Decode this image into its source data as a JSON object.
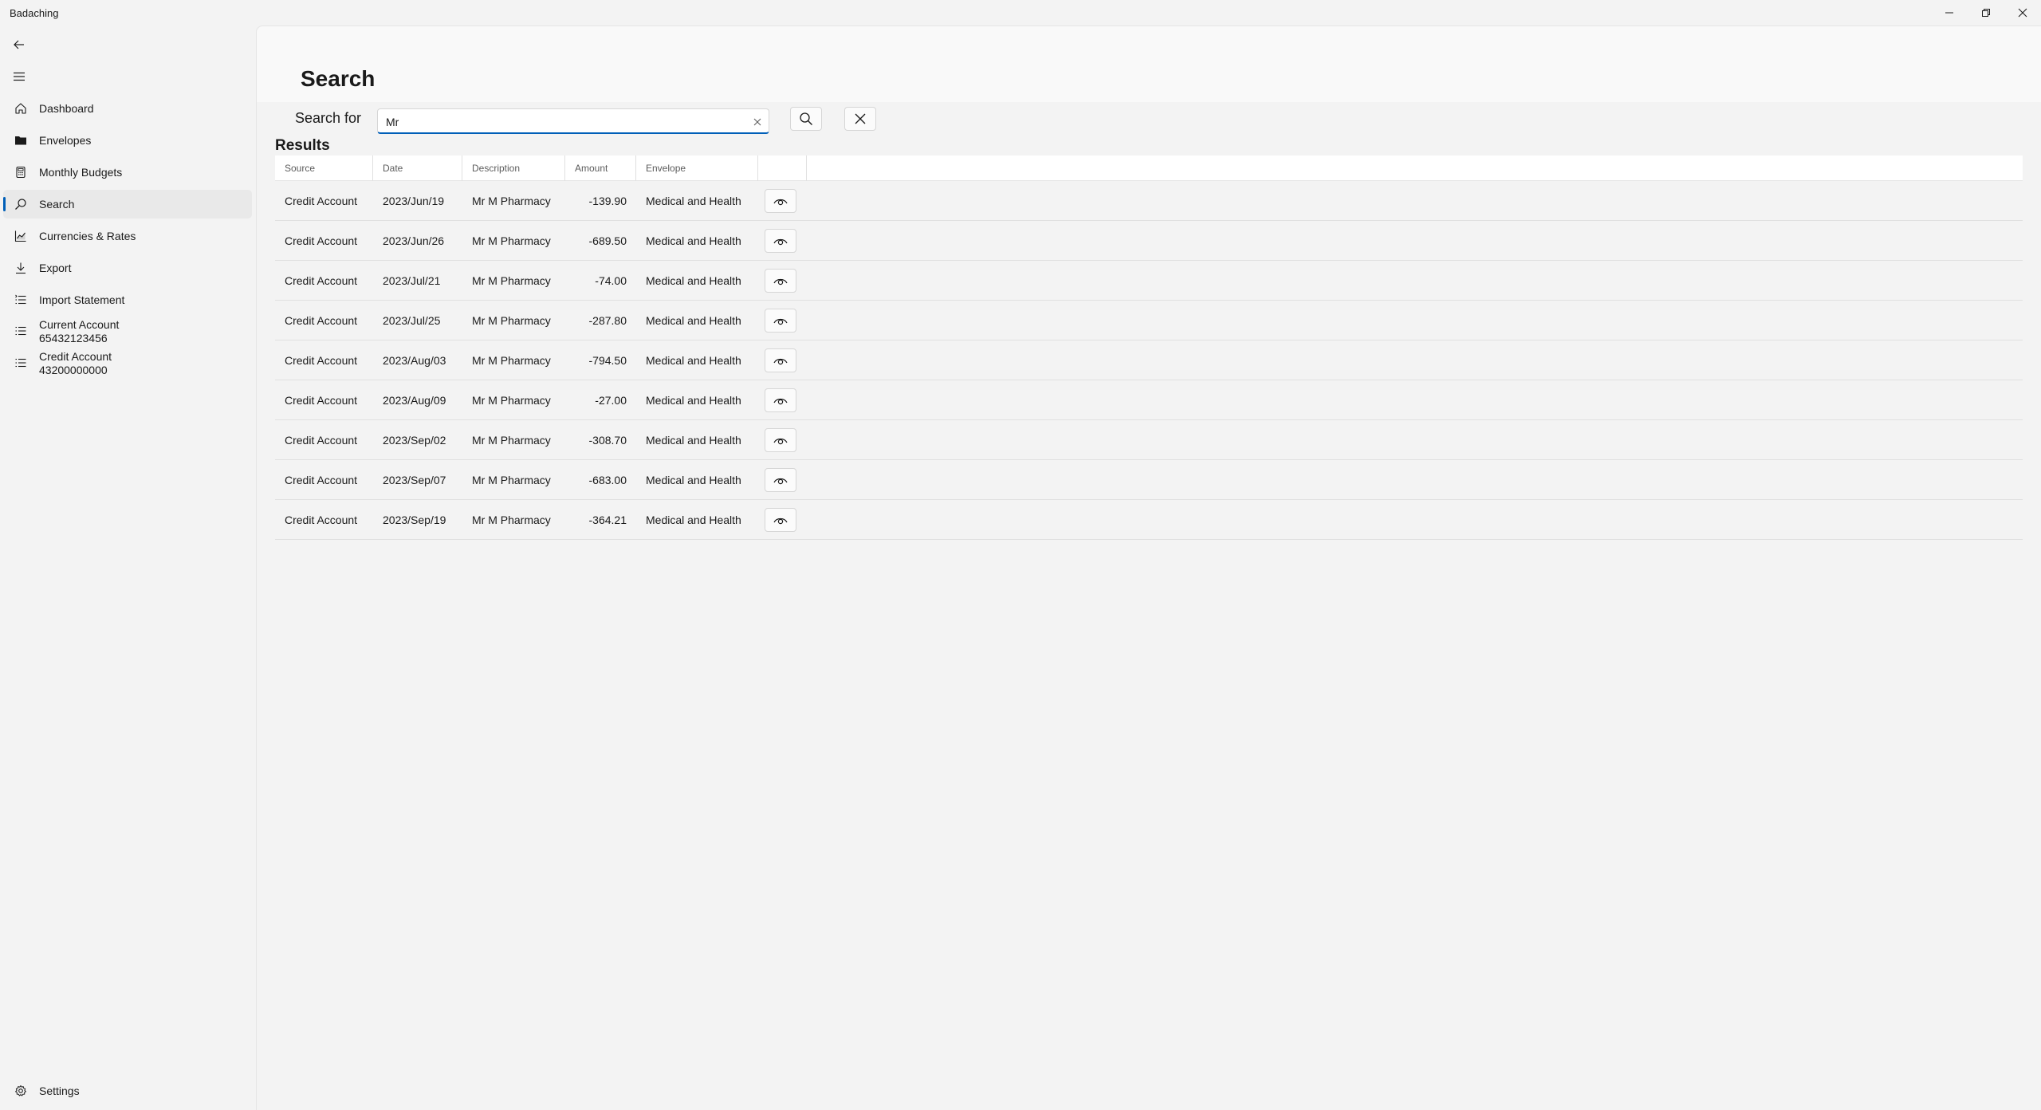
{
  "app": {
    "title": "Badaching"
  },
  "sidebar": {
    "items": [
      {
        "label": "Dashboard",
        "icon": "home-icon"
      },
      {
        "label": "Envelopes",
        "icon": "folder-icon"
      },
      {
        "label": "Monthly Budgets",
        "icon": "calculator-icon"
      },
      {
        "label": "Search",
        "icon": "search-icon",
        "selected": true
      },
      {
        "label": "Currencies & Rates",
        "icon": "chart-icon"
      },
      {
        "label": "Export",
        "icon": "download-icon"
      },
      {
        "label": "Import Statement",
        "icon": "list-import-icon"
      }
    ],
    "accounts": [
      {
        "name": "Current Account",
        "number": "65432123456"
      },
      {
        "name": "Credit Account",
        "number": "43200000000"
      }
    ],
    "settings_label": "Settings"
  },
  "main": {
    "title": "Search",
    "search_label": "Search for",
    "search_value": "Mr",
    "results_title": "Results"
  },
  "table": {
    "headers": [
      "Source",
      "Date",
      "Description",
      "Amount",
      "Envelope"
    ],
    "rows": [
      [
        "Credit Account",
        "2023/Jun/19",
        "Mr M Pharmacy",
        "-139.90",
        "Medical and Health"
      ],
      [
        "Credit Account",
        "2023/Jun/26",
        "Mr M Pharmacy",
        "-689.50",
        "Medical and Health"
      ],
      [
        "Credit Account",
        "2023/Jul/21",
        "Mr M Pharmacy",
        "-74.00",
        "Medical and Health"
      ],
      [
        "Credit Account",
        "2023/Jul/25",
        "Mr M Pharmacy",
        "-287.80",
        "Medical and Health"
      ],
      [
        "Credit Account",
        "2023/Aug/03",
        "Mr M Pharmacy",
        "-794.50",
        "Medical and Health"
      ],
      [
        "Credit Account",
        "2023/Aug/09",
        "Mr M Pharmacy",
        "-27.00",
        "Medical and Health"
      ],
      [
        "Credit Account",
        "2023/Sep/02",
        "Mr M Pharmacy",
        "-308.70",
        "Medical and Health"
      ],
      [
        "Credit Account",
        "2023/Sep/07",
        "Mr M Pharmacy",
        "-683.00",
        "Medical and Health"
      ],
      [
        "Credit Account",
        "2023/Sep/19",
        "Mr M Pharmacy",
        "-364.21",
        "Medical and Health"
      ]
    ]
  },
  "colors": {
    "accent": "#005fb8",
    "background": "#f3f3f3"
  }
}
